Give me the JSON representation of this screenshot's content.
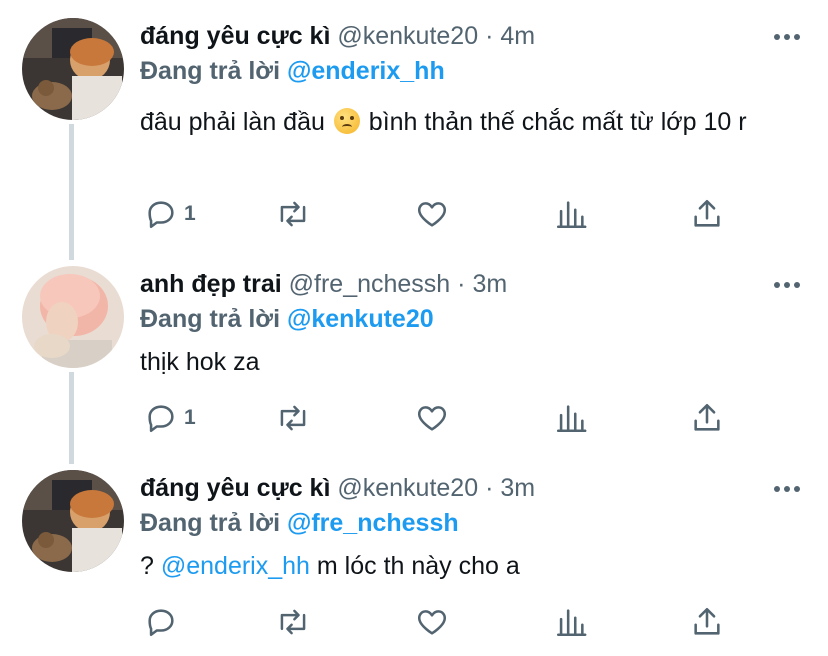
{
  "colors": {
    "accent": "#1d9bf0",
    "text": "#0f1419",
    "muted": "#536471",
    "line": "#cfd9de"
  },
  "replying_prefix": "Đang trả lời",
  "tweets": [
    {
      "name": "đáng yêu cực kì",
      "handle": "@kenkute20",
      "time": "4m",
      "reply_to": "@enderix_hh",
      "text_before": "đâu phải làn đầu",
      "emoji": "persevering-face",
      "text_after": " bình thản thế chắc mất từ lớp 10 r",
      "reply_count": "1"
    },
    {
      "name": "anh đẹp trai",
      "handle": "@fre_nchessh",
      "time": "3m",
      "reply_to": "@kenkute20",
      "text": "thịk hok za",
      "reply_count": "1"
    },
    {
      "name": "đáng yêu cực kì",
      "handle": "@kenkute20",
      "time": "3m",
      "reply_to": "@fre_nchessh",
      "text_prefix": "? ",
      "text_mention": "@enderix_hh",
      "text_rest": " m lóc th này cho a",
      "reply_count": ""
    }
  ],
  "separator": "·"
}
